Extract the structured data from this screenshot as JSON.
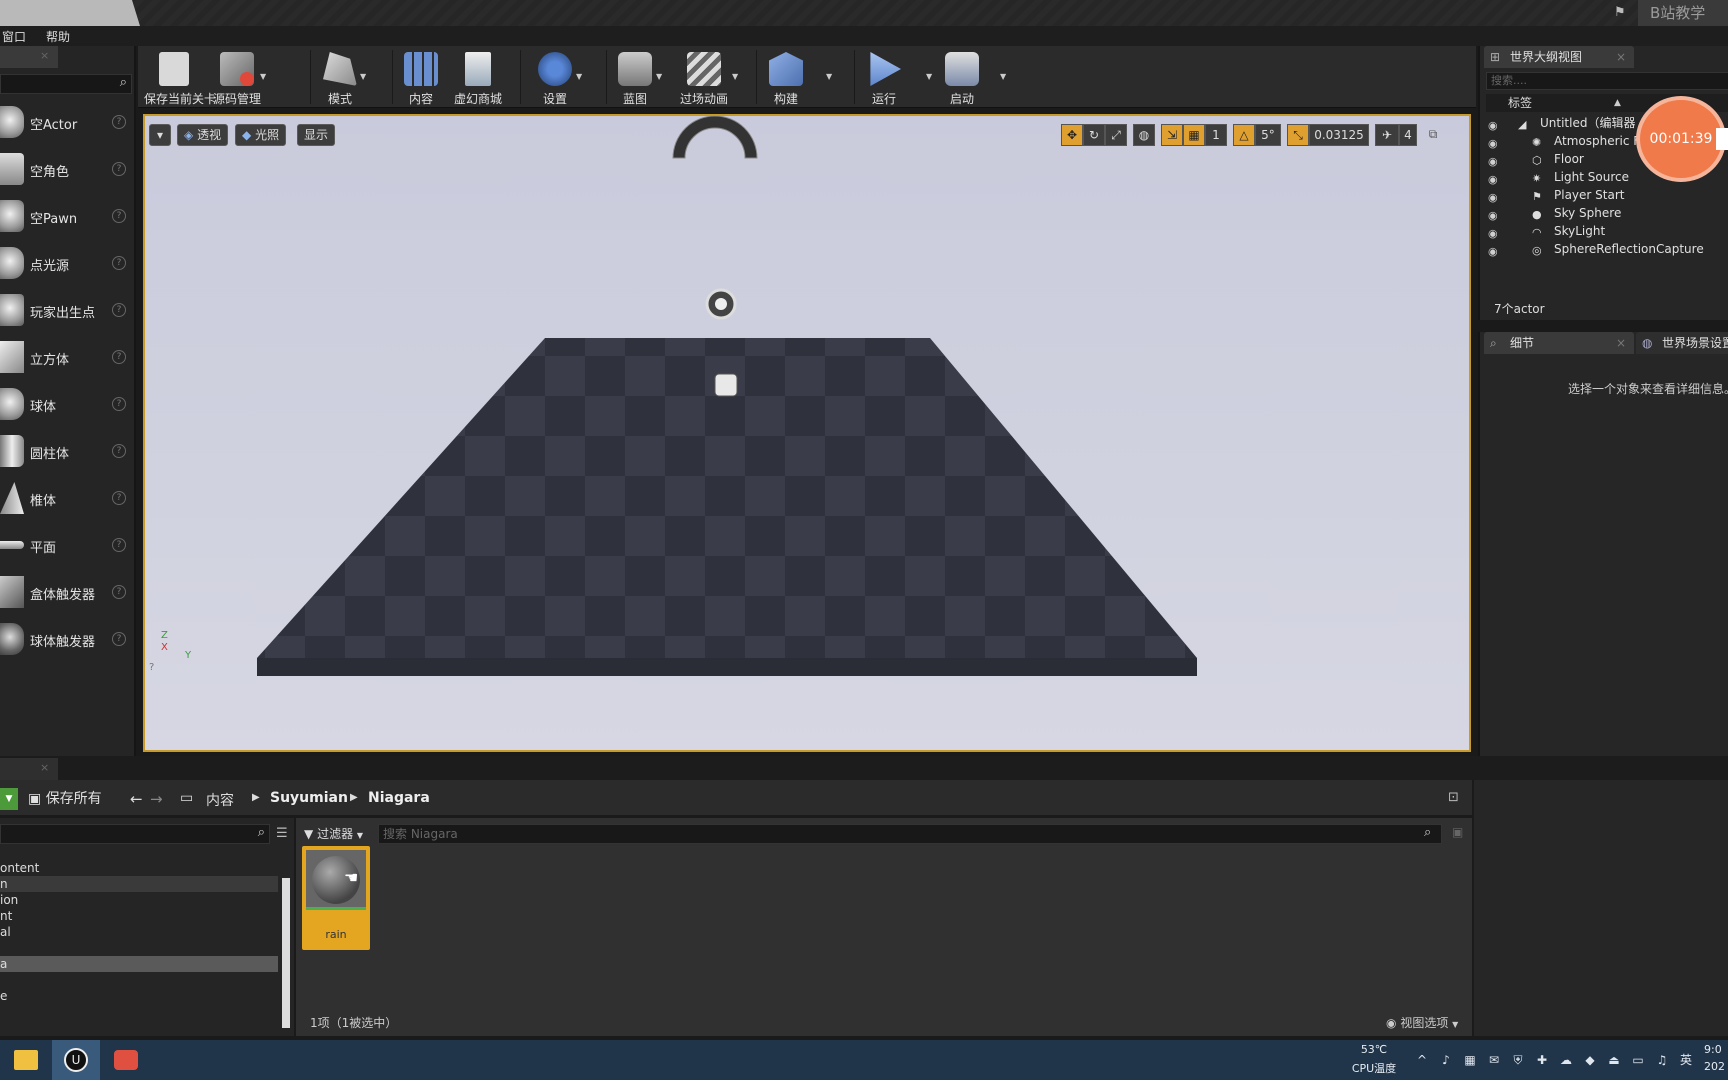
{
  "titlebar": {
    "brand": "B站教学"
  },
  "menu": {
    "items": [
      "窗口",
      "帮助"
    ]
  },
  "place_panel": {
    "items": [
      {
        "label": "空Actor"
      },
      {
        "label": "空角色"
      },
      {
        "label": "空Pawn"
      },
      {
        "label": "点光源"
      },
      {
        "label": "玩家出生点"
      },
      {
        "label": "立方体"
      },
      {
        "label": "球体"
      },
      {
        "label": "圆柱体"
      },
      {
        "label": "椎体"
      },
      {
        "label": "平面"
      },
      {
        "label": "盒体触发器"
      },
      {
        "label": "球体触发器"
      }
    ]
  },
  "toolbar": {
    "buttons": [
      {
        "label": "保存当前关卡"
      },
      {
        "label": "源码管理"
      },
      {
        "label": "模式"
      },
      {
        "label": "内容"
      },
      {
        "label": "虚幻商城"
      },
      {
        "label": "设置"
      },
      {
        "label": "蓝图"
      },
      {
        "label": "过场动画"
      },
      {
        "label": "构建"
      },
      {
        "label": "运行"
      },
      {
        "label": "启动"
      }
    ]
  },
  "viewport": {
    "perspective_label": "透视",
    "lighting_label": "光照",
    "show_label": "显示",
    "grid_snap_value": "1",
    "rotation_snap_value": "5°",
    "scale_snap_value": "0.03125",
    "camera_speed_value": "4",
    "axis_x": "X",
    "axis_y": "Y",
    "axis_z": "Z"
  },
  "outliner": {
    "tab_label": "世界大纲视图",
    "search_placeholder": "搜索....",
    "column_label": "标签",
    "rows": [
      {
        "label": "Untitled（编辑器"
      },
      {
        "label": "Atmospheric Fo"
      },
      {
        "label": "Floor"
      },
      {
        "label": "Light Source"
      },
      {
        "label": "Player Start"
      },
      {
        "label": "Sky Sphere"
      },
      {
        "label": "SkyLight"
      },
      {
        "label": "SphereReflectionCapture"
      }
    ],
    "count_label": "7个actor"
  },
  "details": {
    "tab_label": "细节",
    "tab2_label": "世界场景设置",
    "empty_message": "选择一个对象来查看详细信息。"
  },
  "recording": {
    "time": "00:01:39"
  },
  "content_browser": {
    "save_all_label": "保存所有",
    "breadcrumb": [
      "内容",
      "Suyumian",
      "Niagara"
    ],
    "filter_label": "过滤器",
    "search_placeholder": "搜索 Niagara",
    "tree_items": [
      "ontent",
      "n",
      "ion",
      "nt",
      "al",
      "a",
      "e"
    ],
    "assets": [
      {
        "label": "rain"
      }
    ],
    "status": "1项（1被选中）",
    "view_options": "视图选项"
  },
  "taskbar": {
    "temp": "53℃",
    "temp_label": "CPU温度",
    "ime": "英",
    "time": "9:0",
    "date": "202"
  }
}
